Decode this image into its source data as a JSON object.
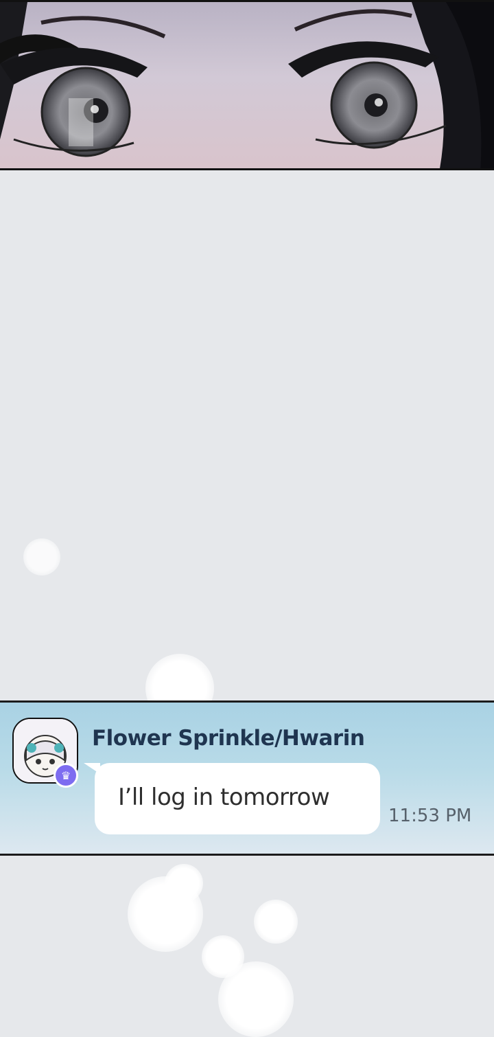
{
  "chat": {
    "sender_name": "Flower Sprinkle/Hwarin",
    "message": "I’ll log in tomorrow",
    "timestamp": "11:53 PM",
    "avatar_icon": "chibi-girl-avatar",
    "badge_icon": "crown-icon",
    "badge_color": "#7d6cf0"
  },
  "panel_art": {
    "description_icon": "close-up-eyes-illustration"
  }
}
